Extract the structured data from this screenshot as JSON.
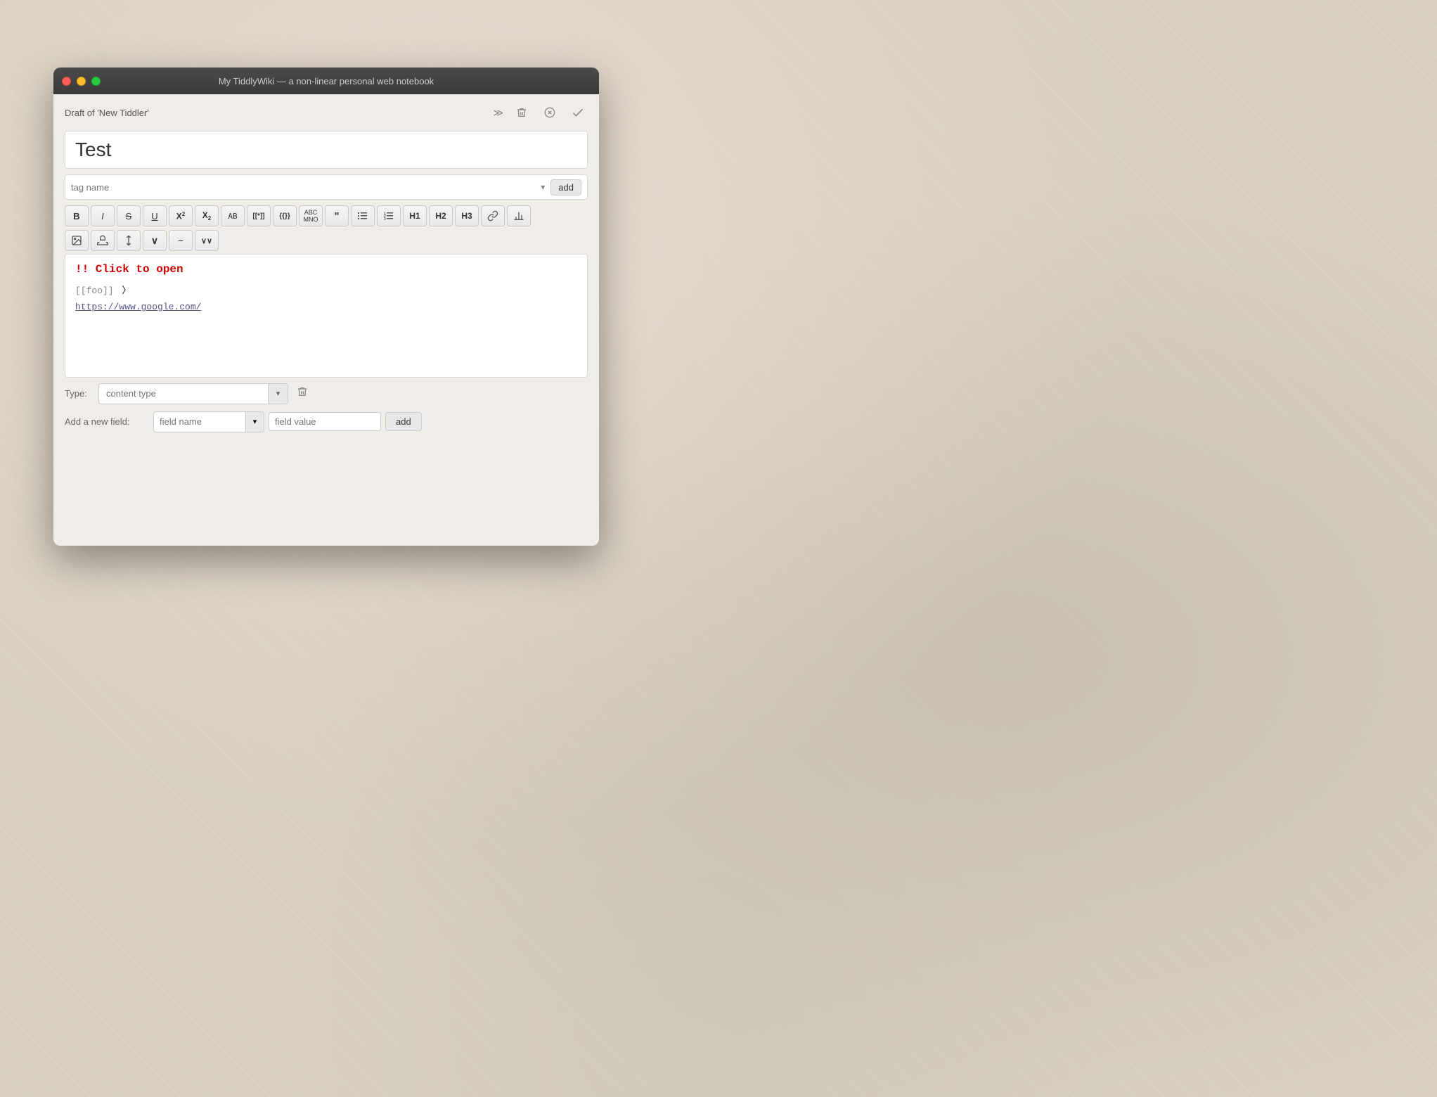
{
  "window": {
    "title": "My TiddlyWiki — a non-linear personal web notebook",
    "traffic_lights": {
      "red_label": "close",
      "yellow_label": "minimize",
      "green_label": "maximize"
    }
  },
  "editor": {
    "draft_label": "Draft of 'New Tiddler'",
    "title_placeholder": "Test",
    "title_value": "Test",
    "tag_placeholder": "tag name",
    "tag_add_label": "add",
    "toolbar": {
      "row1": [
        {
          "id": "bold",
          "label": "B"
        },
        {
          "id": "italic",
          "label": "I"
        },
        {
          "id": "strikethrough",
          "label": "S"
        },
        {
          "id": "underline",
          "label": "U"
        },
        {
          "id": "superscript",
          "label": "X²"
        },
        {
          "id": "subscript",
          "label": "X₂"
        },
        {
          "id": "mono",
          "label": "AB"
        },
        {
          "id": "macro1",
          "label": "[[*]]"
        },
        {
          "id": "macro2",
          "label": "{{}}}"
        },
        {
          "id": "abc",
          "label": "ABC↵"
        },
        {
          "id": "quote",
          "label": "❝❞"
        },
        {
          "id": "bullet",
          "label": "≡•"
        },
        {
          "id": "numbered",
          "label": "≡1"
        },
        {
          "id": "h1",
          "label": "H1"
        },
        {
          "id": "h2",
          "label": "H2"
        },
        {
          "id": "h3",
          "label": "H3"
        },
        {
          "id": "link",
          "label": "🔗"
        },
        {
          "id": "chart",
          "label": "📊"
        }
      ],
      "row2": [
        {
          "id": "image",
          "label": "🖼"
        },
        {
          "id": "stamp",
          "label": "⬛"
        },
        {
          "id": "arrows",
          "label": "↕"
        },
        {
          "id": "chevron-down",
          "label": "∨"
        },
        {
          "id": "tilde",
          "label": "~~"
        },
        {
          "id": "chevron-more",
          "label": "∨∨"
        }
      ]
    },
    "content": {
      "line1": "!! Click to open",
      "line2": "[[foo]]",
      "line3": "https://www.google.com/"
    },
    "type_label": "Type:",
    "type_placeholder": "content type",
    "type_value": "content type",
    "add_field_label": "Add a new field:",
    "field_name_placeholder": "field name",
    "field_value_placeholder": "field value",
    "field_add_label": "add"
  },
  "icons": {
    "trash": "🗑",
    "close_circle": "✕",
    "double_check": "✓✓",
    "dropdown": "▾",
    "trash_small": "🗑"
  }
}
